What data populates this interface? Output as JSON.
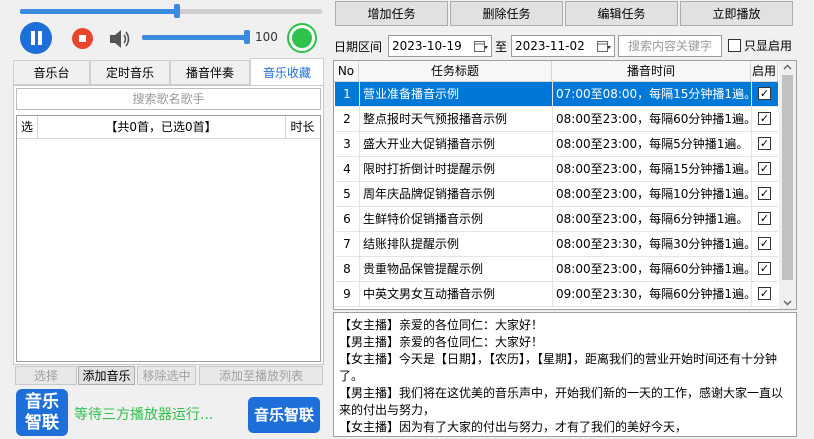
{
  "player": {
    "volume": "100",
    "volume_level": 1.0,
    "progress_level": 0.52
  },
  "left_tabs": [
    "音乐台",
    "定时音乐",
    "播音伴奏",
    "音乐收藏"
  ],
  "left_search": {
    "placeholder": "搜索歌名歌手"
  },
  "music_table": {
    "col_select": "选",
    "summary": "【共0首，已选0首】",
    "col_duration": "时长"
  },
  "left_buttons": {
    "select": "选择",
    "add_music": "添加音乐",
    "remove_selected": "移除选中",
    "add_to_playlist": "添加至播放列表"
  },
  "footer": {
    "logo_line1": "音乐",
    "logo_line2": "智联",
    "status": "等待三方播放器运行...",
    "brand_button": "音乐智联"
  },
  "task_toolbar": {
    "add": "增加任务",
    "delete": "删除任务",
    "edit": "编辑任务",
    "play_now": "立即播放"
  },
  "filter": {
    "date_label": "日期区间",
    "start_date": "2023-10-19",
    "to_label": "至",
    "end_date": "2023-11-02",
    "search_placeholder": "搜索内容关键字",
    "only_enabled": "只显启用"
  },
  "task_table": {
    "headers": {
      "no": "No",
      "title": "任务标题",
      "time": "播音时间",
      "enabled": "启用"
    },
    "rows": [
      {
        "no": "1",
        "title": "营业准备播音示例",
        "time": "07:00至08:00，每隔15分钟播1遍。",
        "enabled": true,
        "selected": true
      },
      {
        "no": "2",
        "title": "整点报时天气预报播音示例",
        "time": "08:00至23:00，每隔60分钟播1遍。",
        "enabled": true,
        "selected": false
      },
      {
        "no": "3",
        "title": "盛大开业大促销播音示例",
        "time": "08:00至23:00，每隔5分钟播1遍。",
        "enabled": true,
        "selected": false
      },
      {
        "no": "4",
        "title": "限时打折倒计时提醒示例",
        "time": "08:00至23:00，每隔15分钟播1遍。",
        "enabled": true,
        "selected": false
      },
      {
        "no": "5",
        "title": "周年庆品牌促销播音示例",
        "time": "08:00至23:00，每隔10分钟播1遍。",
        "enabled": true,
        "selected": false
      },
      {
        "no": "6",
        "title": "生鲜特价促销播音示例",
        "time": "08:00至23:00，每隔6分钟播1遍。",
        "enabled": true,
        "selected": false
      },
      {
        "no": "7",
        "title": "结账排队提醒示例",
        "time": "08:00至23:30，每隔30分钟播1遍。",
        "enabled": true,
        "selected": false
      },
      {
        "no": "8",
        "title": "贵重物品保管提醒示例",
        "time": "08:00至23:00，每隔60分钟播1遍。",
        "enabled": true,
        "selected": false
      },
      {
        "no": "9",
        "title": "中英文男女互动播音示例",
        "time": "09:00至23:30，每隔60分钟播1遍。",
        "enabled": true,
        "selected": false
      }
    ]
  },
  "script_lines": [
    "【女主播】亲爱的各位同仁：大家好！",
    "【男主播】亲爱的各位同仁：大家好！",
    "【女主播】今天是【日期】，【农历】，【星期】，距离我们的营业开始时间还有十分钟了。",
    "【男主播】我们将在这优美的音乐声中，开始我们新的一天的工作，感谢大家一直以来的付出与努力，",
    "【女主播】因为有了大家的付出与努力，才有了我们的美好今天，"
  ],
  "colors": {
    "accent": "#1e6fd9",
    "selection": "#0078d7",
    "green": "#2ec24a",
    "stop": "#e8472e"
  }
}
